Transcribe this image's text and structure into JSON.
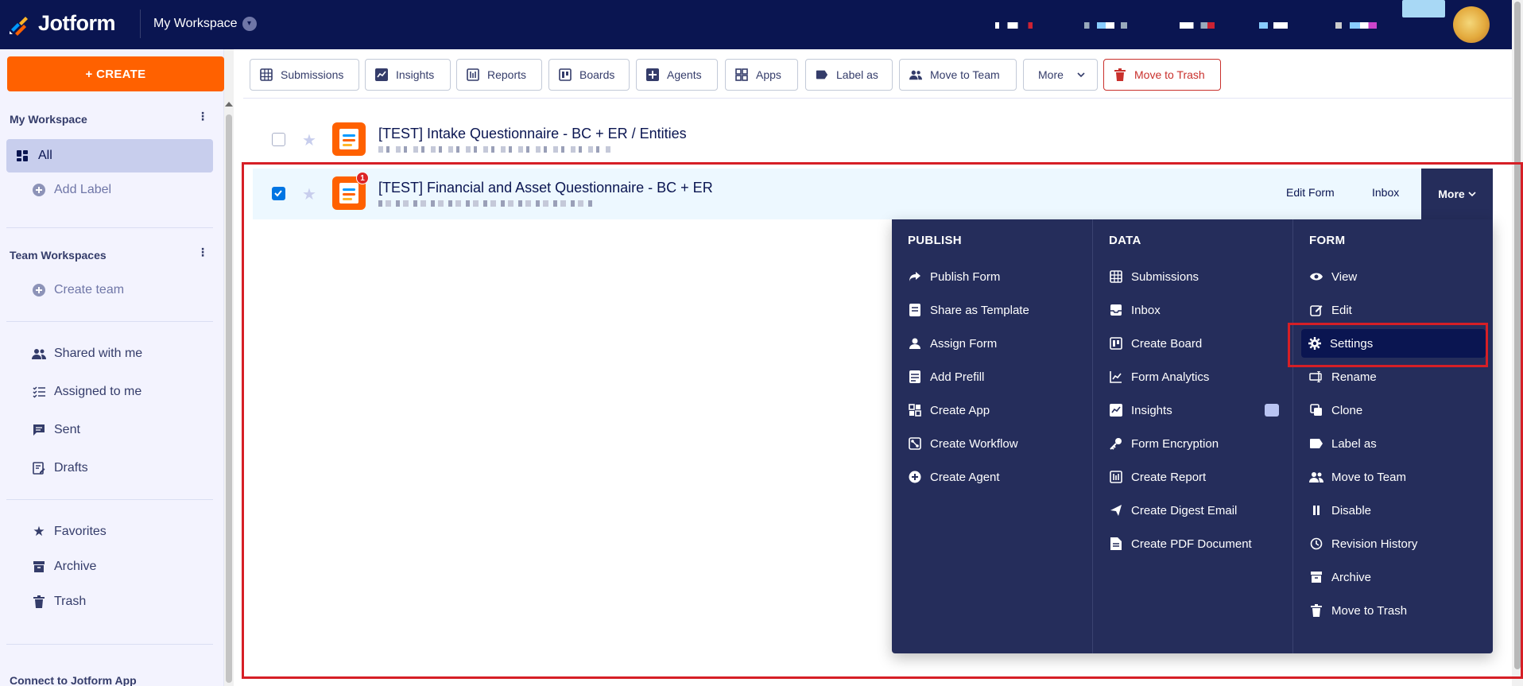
{
  "brand": {
    "logo_text": "Jotform",
    "workspace": "My Workspace"
  },
  "sidebar": {
    "create_label": "+ CREATE",
    "my_workspace_head": "My Workspace",
    "all_label": "All",
    "add_label": "Add Label",
    "team_head": "Team Workspaces",
    "create_team": "Create team",
    "items": [
      {
        "label": "Shared with me",
        "icon": "users-icon"
      },
      {
        "label": "Assigned to me",
        "icon": "checklist-icon"
      },
      {
        "label": "Sent",
        "icon": "message-icon"
      },
      {
        "label": "Drafts",
        "icon": "draft-icon"
      }
    ],
    "items2": [
      {
        "label": "Favorites",
        "icon": "star-icon"
      },
      {
        "label": "Archive",
        "icon": "archive-icon"
      },
      {
        "label": "Trash",
        "icon": "trash-icon"
      }
    ],
    "footer": "Connect to Jotform App"
  },
  "toolbar": {
    "buttons": [
      {
        "label": "Submissions",
        "icon": "grid-icon"
      },
      {
        "label": "Insights",
        "icon": "chart-icon"
      },
      {
        "label": "Reports",
        "icon": "report-icon"
      },
      {
        "label": "Boards",
        "icon": "board-icon"
      },
      {
        "label": "Agents",
        "icon": "agent-icon"
      },
      {
        "label": "Apps",
        "icon": "apps-icon"
      },
      {
        "label": "Label as",
        "icon": "tag-icon"
      },
      {
        "label": "Move to Team",
        "icon": "team-icon"
      },
      {
        "label": "More",
        "icon": "chevron-down-icon"
      },
      {
        "label": "Move to Trash",
        "icon": "trash-icon"
      }
    ]
  },
  "forms": [
    {
      "title": "[TEST] Intake Questionnaire - BC + ER / Entities",
      "selected": false
    },
    {
      "title": "[TEST] Financial and Asset Questionnaire - BC + ER",
      "selected": true,
      "badge": "1",
      "actions": {
        "edit": "Edit Form",
        "inbox": "Inbox",
        "more": "More"
      }
    }
  ],
  "menu": {
    "publish": {
      "head": "PUBLISH",
      "items": [
        "Publish Form",
        "Share as Template",
        "Assign Form",
        "Add Prefill",
        "Create App",
        "Create Workflow",
        "Create Agent"
      ]
    },
    "data": {
      "head": "DATA",
      "items": [
        "Submissions",
        "Inbox",
        "Create Board",
        "Form Analytics",
        "Insights",
        "Form Encryption",
        "Create Report",
        "Create Digest Email",
        "Create PDF Document"
      ]
    },
    "form": {
      "head": "FORM",
      "items": [
        "View",
        "Edit",
        "Settings",
        "Rename",
        "Clone",
        "Label as",
        "Move to Team",
        "Disable",
        "Revision History",
        "Archive",
        "Move to Trash"
      ],
      "active": "Settings"
    }
  },
  "colors": {
    "navy": "#0a1551",
    "orange": "#ff6100",
    "menu_bg": "#252d5b",
    "highlight": "#d61f26"
  }
}
